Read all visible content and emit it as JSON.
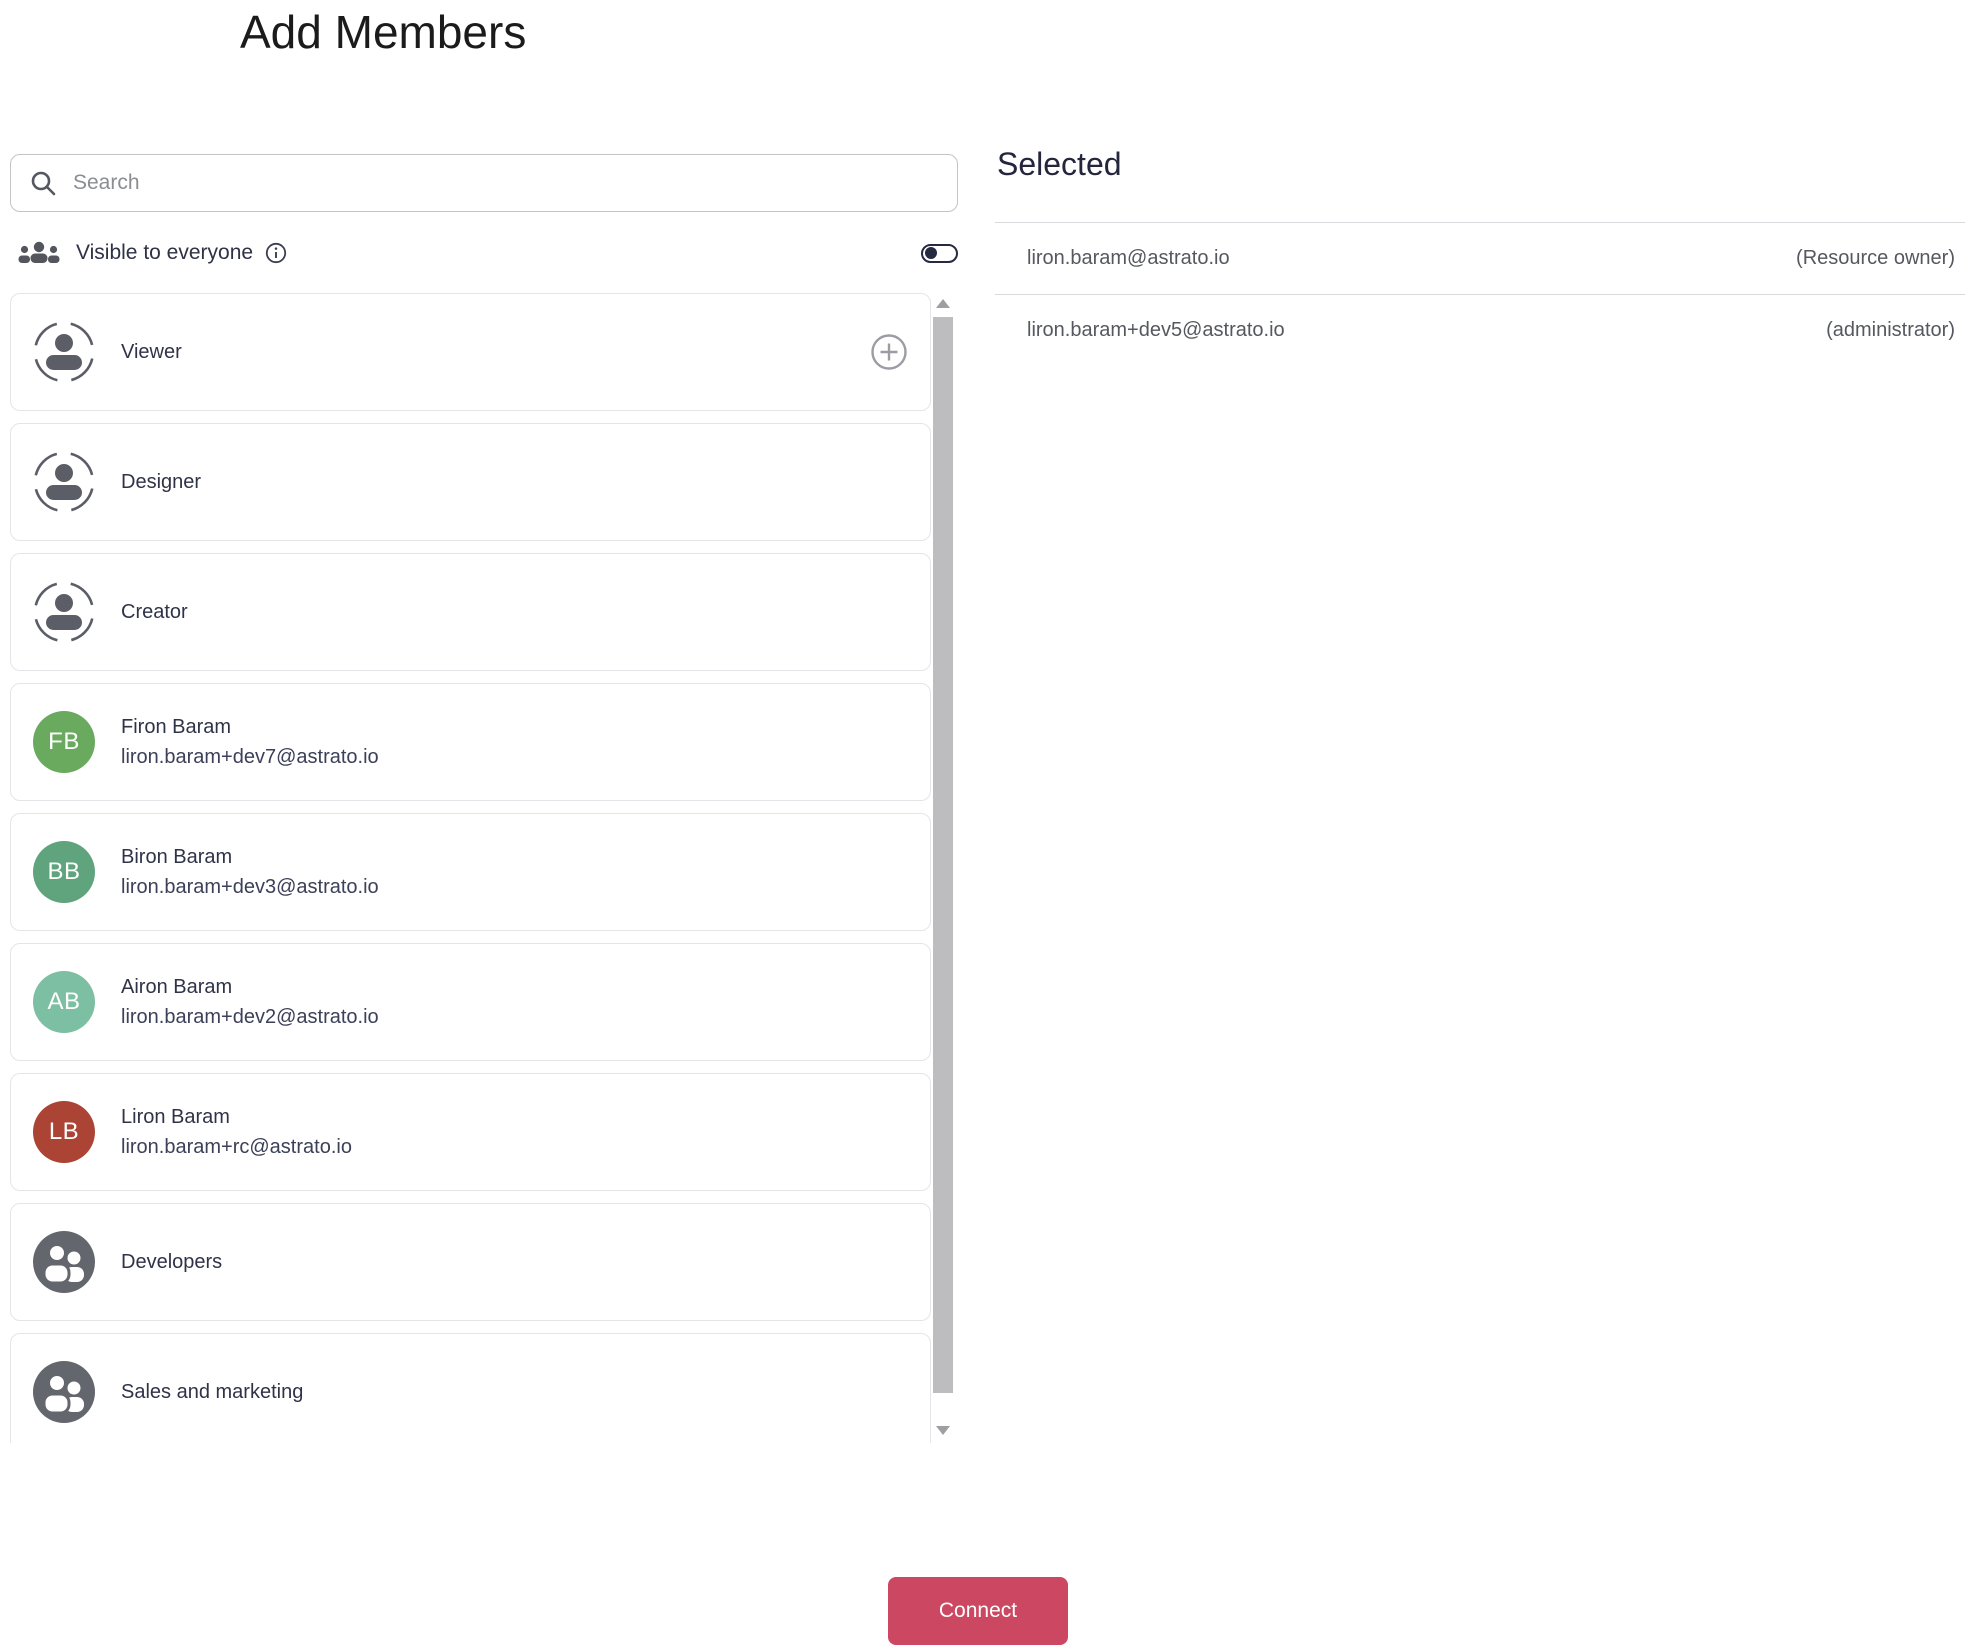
{
  "page": {
    "title": "Add Members"
  },
  "search": {
    "placeholder": "Search"
  },
  "visibility": {
    "label": "Visible to everyone",
    "toggle_on": false
  },
  "members": {
    "items": [
      {
        "type": "role",
        "label": "Viewer"
      },
      {
        "type": "role",
        "label": "Designer"
      },
      {
        "type": "role",
        "label": "Creator"
      },
      {
        "type": "user",
        "name": "Firon Baram",
        "email": "liron.baram+dev7@astrato.io",
        "initials": "FB",
        "avatar_color": "#6aaa5f"
      },
      {
        "type": "user",
        "name": "Biron Baram",
        "email": "liron.baram+dev3@astrato.io",
        "initials": "BB",
        "avatar_color": "#5fa47d"
      },
      {
        "type": "user",
        "name": "Airon Baram",
        "email": "liron.baram+dev2@astrato.io",
        "initials": "AB",
        "avatar_color": "#7dbfa2"
      },
      {
        "type": "user",
        "name": "Liron Baram",
        "email": "liron.baram+rc@astrato.io",
        "initials": "LB",
        "avatar_color": "#ab4434"
      },
      {
        "type": "group",
        "label": "Developers"
      },
      {
        "type": "group",
        "label": "Sales and marketing"
      }
    ]
  },
  "selected": {
    "heading": "Selected",
    "rows": [
      {
        "email": "liron.baram@astrato.io",
        "role": "(Resource owner)"
      },
      {
        "email": "liron.baram+dev5@astrato.io",
        "role": "(administrator)"
      }
    ]
  },
  "footer": {
    "connect_label": "Connect"
  },
  "colors": {
    "accent_red": "#cc4862",
    "avatar_green": "#6aaa5f",
    "avatar_teal_dark": "#5fa47d",
    "avatar_teal": "#7dbfa2",
    "avatar_red": "#ab4434",
    "icon_gray": "#64666e",
    "toggle_dark": "#262a41"
  }
}
